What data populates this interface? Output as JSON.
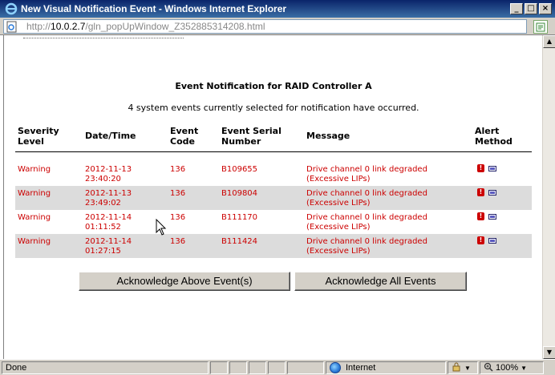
{
  "window": {
    "title": "New Visual Notification Event - Windows Internet Explorer",
    "buttons": {
      "minimize": "_",
      "maximize": "□",
      "close": "×"
    }
  },
  "address": {
    "scheme": "http://",
    "host": "10.0.2.7",
    "path": "/gln_popUpWindow_Z352885314208.html"
  },
  "page": {
    "heading": "Event Notification for RAID Controller A",
    "subheading": "4 system events currently selected for notification have occurred.",
    "columns": {
      "severity_line1": "Severity",
      "severity_line2": "Level",
      "datetime": "Date/Time",
      "code_line1": "Event",
      "code_line2": "Code",
      "serial_line1": "Event Serial",
      "serial_line2": "Number",
      "message": "Message",
      "alert_line1": "Alert",
      "alert_line2": "Method"
    },
    "events": [
      {
        "severity": "Warning",
        "date": "2012-11-13",
        "time": "23:40:20",
        "code": "136",
        "serial": "B109655",
        "message_line1": "Drive channel 0 link degraded",
        "message_line2": "(Excessive LIPs)"
      },
      {
        "severity": "Warning",
        "date": "2012-11-13",
        "time": "23:49:02",
        "code": "136",
        "serial": "B109804",
        "message_line1": "Drive channel 0 link degraded",
        "message_line2": "(Excessive LIPs)"
      },
      {
        "severity": "Warning",
        "date": "2012-11-14",
        "time": "01:11:52",
        "code": "136",
        "serial": "B111170",
        "message_line1": "Drive channel 0 link degraded",
        "message_line2": "(Excessive LIPs)"
      },
      {
        "severity": "Warning",
        "date": "2012-11-14",
        "time": "01:27:15",
        "code": "136",
        "serial": "B111424",
        "message_line1": "Drive channel 0 link degraded",
        "message_line2": "(Excessive LIPs)"
      }
    ],
    "buttons": {
      "ack_above": "Acknowledge Above Event(s)",
      "ack_all": "Acknowledge All Events"
    },
    "alert_icons": [
      "exclamation-icon",
      "mail-icon"
    ]
  },
  "statusbar": {
    "status": "Done",
    "zone": "Internet",
    "zoom": "100%"
  },
  "colors": {
    "event_text": "#cc0000",
    "alt_row": "#dcdcdc",
    "titlebar": "#0a246a"
  }
}
